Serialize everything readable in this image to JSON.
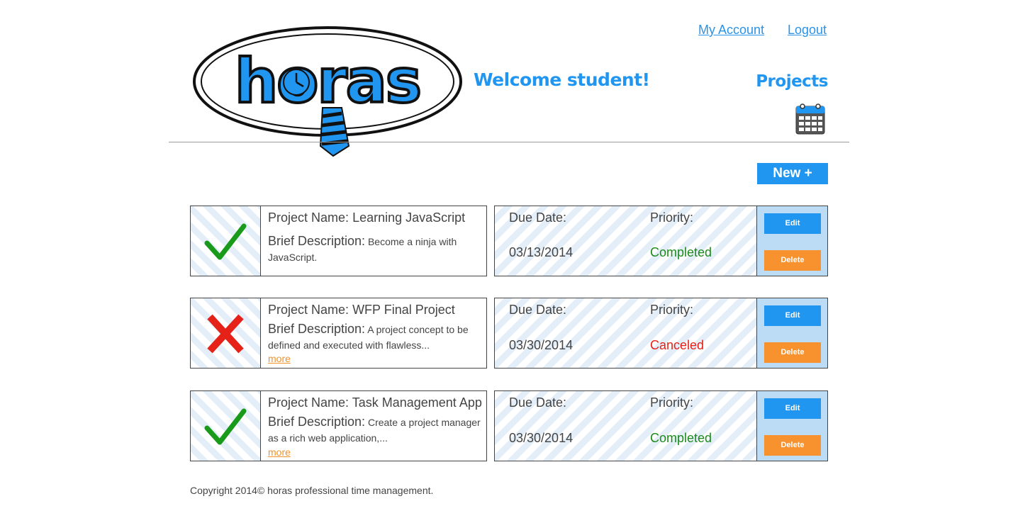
{
  "header": {
    "logo_text": "horas",
    "welcome": "Welcome student!",
    "nav": {
      "my_account": "My Account",
      "logout": "Logout"
    },
    "projects_title": "Projects",
    "new_button": "New +"
  },
  "labels": {
    "project_name": "Project Name:",
    "brief_description": "Brief Description:",
    "due_date": "Due Date:",
    "priority": "Priority:",
    "edit": "Edit",
    "delete": "Delete",
    "more": "more"
  },
  "projects": [
    {
      "name": "Learning JavaScript",
      "description": "Become a ninja with JavaScript.",
      "due_date": "03/13/2014",
      "priority": "Completed",
      "status_icon": "checkmark-icon",
      "status_color": "#1a9a1a",
      "has_more": false
    },
    {
      "name": "WFP Final Project",
      "description": "A project concept to be defined and executed with flawless...",
      "due_date": "03/30/2014",
      "priority": "Canceled",
      "status_icon": "x-icon",
      "status_color": "#e62117",
      "has_more": true
    },
    {
      "name": "Task Management App",
      "description": "Create a project manager as a rich web application,...",
      "due_date": "03/30/2014",
      "priority": "Completed",
      "status_icon": "checkmark-icon",
      "status_color": "#1a9a1a",
      "has_more": true
    }
  ],
  "footer": {
    "copyright": "Copyright 2014© horas professional time management."
  },
  "colors": {
    "accent": "#2196f0",
    "delete": "#f7922e",
    "completed": "#1a8a1a",
    "canceled": "#e62117"
  }
}
